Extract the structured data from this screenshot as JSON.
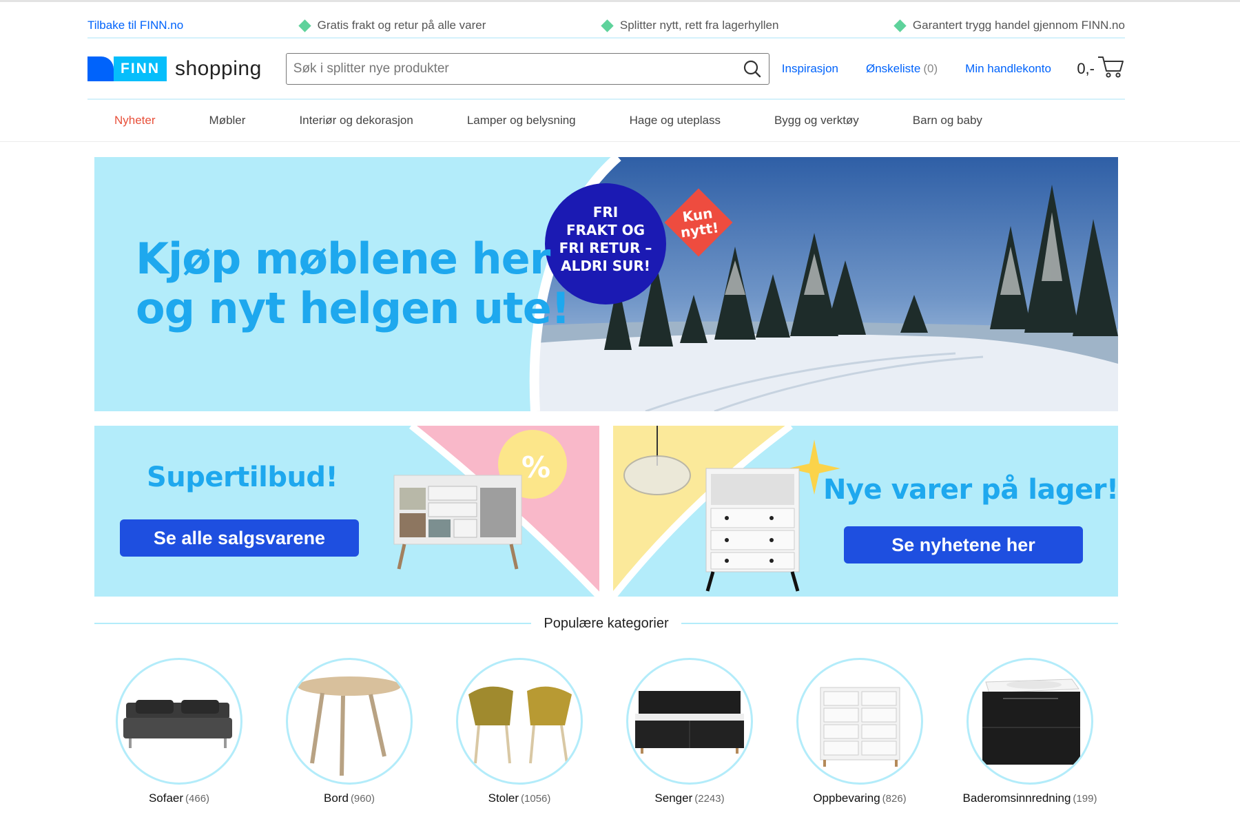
{
  "topbar": {
    "back_link": "Tilbake til FINN.no",
    "usps": [
      "Gratis frakt og retur på alle varer",
      "Splitter nytt, rett fra lagerhyllen",
      "Garantert trygg handel gjennom FINN.no"
    ]
  },
  "header": {
    "logo_finn": "FINN",
    "logo_word": "shopping",
    "search_placeholder": "Søk i splitter nye produkter",
    "links": {
      "inspiration": "Inspirasjon",
      "wishlist": "Ønskeliste",
      "wishlist_count": "(0)",
      "account": "Min handlekonto"
    },
    "cart_total": "0,-"
  },
  "catnav": {
    "items": [
      "Nyheter",
      "Møbler",
      "Interiør og dekorasjon",
      "Lamper og belysning",
      "Hage og uteplass",
      "Bygg og verktøy",
      "Barn og baby"
    ],
    "active": "Nyheter"
  },
  "hero": {
    "headline_line1": "Kjøp møblene her",
    "headline_line2": "og nyt helgen ute!",
    "badge_lines": [
      "FRI",
      "FRAKT OG",
      "FRI RETUR –",
      "ALDRI SUR!"
    ],
    "tag_lines": [
      "Kun",
      "nytt!"
    ]
  },
  "promos": {
    "left": {
      "title": "Supertilbud!",
      "button": "Se alle salgsvarene",
      "badge": "%"
    },
    "right": {
      "title": "Nye varer på lager!",
      "button": "Se nyhetene her"
    }
  },
  "popular": {
    "heading": "Populære kategorier",
    "items": [
      {
        "name": "Sofaer",
        "count": "(466)"
      },
      {
        "name": "Bord",
        "count": "(960)"
      },
      {
        "name": "Stoler",
        "count": "(1056)"
      },
      {
        "name": "Senger",
        "count": "(2243)"
      },
      {
        "name": "Oppbevaring",
        "count": "(826)"
      },
      {
        "name": "Baderomsinnredning",
        "count": "(199)"
      }
    ]
  },
  "colors": {
    "brand_blue": "#0063fb",
    "finn_cyan": "#06befb",
    "accent_red": "#e8503a",
    "banner_bg": "#b3ecfa",
    "headline": "#1ea8ee",
    "button": "#1e4fe0"
  }
}
